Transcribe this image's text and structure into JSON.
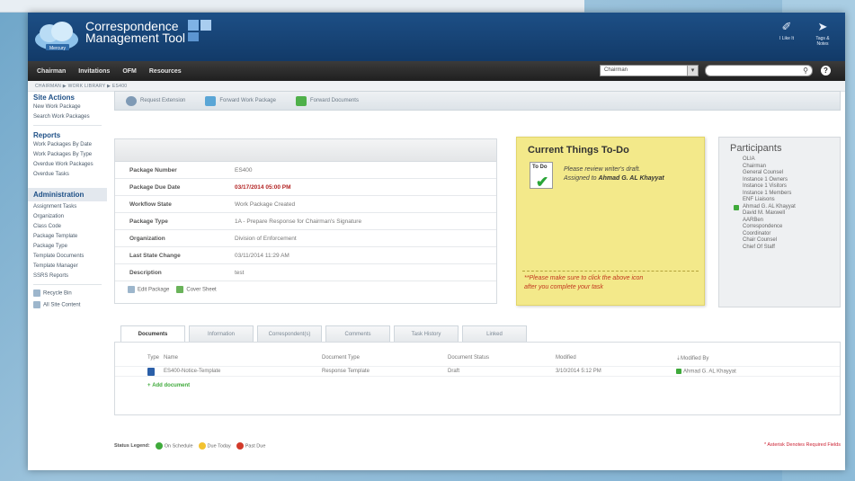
{
  "app": {
    "title_line1": "Correspondence",
    "title_line2": "Management Tool",
    "logo_text": "Mercury"
  },
  "header_tools": [
    {
      "label": "I Like It",
      "icon": "thumbs-up-icon"
    },
    {
      "label": "Tags & Notes",
      "icon": "tag-icon"
    }
  ],
  "nav": {
    "items": [
      "Chairman",
      "Invitations",
      "OFM",
      "Resources"
    ],
    "select_value": "Chairman",
    "search_placeholder": ""
  },
  "breadcrumb": "CHAIRMAN ▶ WORK LIBRARY ▶ ES400",
  "sidebar": {
    "site_actions_title": "Site Actions",
    "site_actions": [
      "New Work Package",
      "Search Work Packages"
    ],
    "reports_title": "Reports",
    "reports": [
      "Work Packages By Date",
      "Work Packages By Type",
      "Overdue Work Packages",
      "Overdue Tasks"
    ],
    "admin_title": "Administration",
    "admin": [
      "Assignment Tasks",
      "Organization",
      "Class Code",
      "Package Template",
      "Package Type",
      "Template Documents",
      "Template Manager",
      "SSRS Reports"
    ],
    "bottom": [
      "Recycle Bin",
      "All Site Content"
    ]
  },
  "toolbar": {
    "request_extension": "Request Extension",
    "forward_work_package": "Forward Work Package",
    "forward_documents": "Forward Documents"
  },
  "package": {
    "rows": [
      {
        "label": "Package Number",
        "value": "ES400"
      },
      {
        "label": "Package Due Date",
        "value": "03/17/2014 05:00 PM"
      },
      {
        "label": "Workflow State",
        "value": "Work Package Created"
      },
      {
        "label": "Package Type",
        "value": "1A - Prepare Response for Chairman's Signature"
      },
      {
        "label": "Organization",
        "value": "Division of Enforcement"
      },
      {
        "label": "Last State Change",
        "value": "03/11/2014 11:29 AM"
      },
      {
        "label": "Description",
        "value": "test"
      }
    ],
    "edit_package": "Edit Package",
    "cover_sheet": "Cover Sheet"
  },
  "todo": {
    "title": "Current Things To-Do",
    "icon_label": "To Do",
    "text_line1": "Please review writer's draft.",
    "text_line2_prefix": "Assigned to",
    "assignee": "Ahmad G. AL Khayyat",
    "note_line1": "**Please make sure to click the above icon",
    "note_line2": "after you complete your task"
  },
  "participants": {
    "title": "Participants",
    "list": [
      "OLIA",
      "Chairman",
      "General Counsel",
      "Instance 1 Owners",
      "Instance 1 Visitors",
      "Instance 1 Members",
      "ENF Liaisons",
      "Ahmad G. AL Khayyat",
      "David M. Maxwell",
      "AARBen",
      "Correspondence",
      "Coordinator",
      "Chair Counsel",
      "Chief Of Staff"
    ],
    "active_index": 7
  },
  "tabs": [
    "Documents",
    "Information",
    "Correspondent(s)",
    "Comments",
    "Task History",
    "Linked"
  ],
  "documents": {
    "headers": {
      "type": "Type",
      "name": "Name",
      "doc_type": "Document Type",
      "status": "Document Status",
      "modified": "Modified",
      "modified_by": "Modified By"
    },
    "row": {
      "name": "ES400-Notice-Template",
      "doc_type": "Response Template",
      "status": "Draft",
      "modified": "3/10/2014 5:12 PM",
      "modified_by": "Ahmad G. AL Khayyat"
    },
    "add": "Add document"
  },
  "footer": {
    "legend_title": "Status Legend:",
    "on_schedule": "On Schedule",
    "due_today": "Due Today",
    "past_due": "Past Due",
    "required_note": "Asterisk Denotes Required Fields",
    "colors": {
      "on_schedule": "#3faa3b",
      "due_today": "#f2c230",
      "past_due": "#d23a2a"
    }
  }
}
